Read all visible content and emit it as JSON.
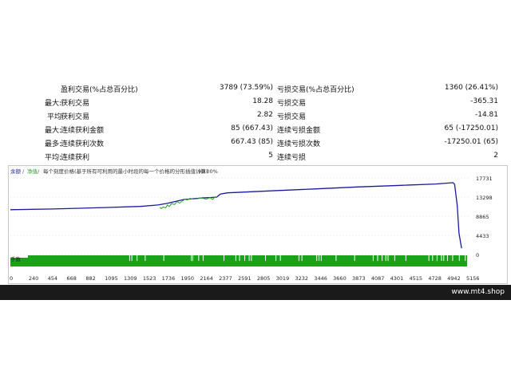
{
  "stats": {
    "rows": [
      {
        "prefix": "",
        "label1": "盈利交易(%占总百分比)",
        "value1": "3789 (73.59%)",
        "label2": "亏损交易(%占总百分比)",
        "value2": "1360 (26.41%)"
      },
      {
        "prefix": "最大:",
        "label1": "获利交易",
        "value1": "18.28",
        "label2": "亏损交易",
        "value2": "-365.31"
      },
      {
        "prefix": "平均",
        "label1": "获利交易",
        "value1": "2.82",
        "label2": "亏损交易",
        "value2": "-14.81"
      },
      {
        "prefix": "最大:",
        "label1": "连续获利金额",
        "value1": "85 (667.43)",
        "label2": "连续亏损金额",
        "value2": "65 (-17250.01)"
      },
      {
        "prefix": "最多:",
        "label1": "连续获利次数",
        "value1": "667.43 (85)",
        "label2": "连续亏损次数",
        "value2": "-17250.01 (65)"
      },
      {
        "prefix": "平均:",
        "label1": "连续获利",
        "value1": "5",
        "label2": "连续亏损",
        "value2": "2"
      }
    ]
  },
  "chart": {
    "legend": {
      "balance": "余额",
      "equity": "净值",
      "separator": "/",
      "description": "每个刻度价格(基于所有可利用的最小时段的每一个价格的分形插值计算)",
      "percent": "90.00%"
    },
    "volume_label": "手数"
  },
  "chart_data": {
    "type": "line",
    "ylim": [
      0,
      19500
    ],
    "yticks": [
      "17731",
      "13298",
      "8865",
      "4433",
      "0"
    ],
    "xlim": [
      0,
      5300
    ],
    "xticks": [
      "0",
      "240",
      "454",
      "668",
      "882",
      "1095",
      "1309",
      "1523",
      "1736",
      "1950",
      "2164",
      "2377",
      "2591",
      "2805",
      "3019",
      "3232",
      "3446",
      "3660",
      "3873",
      "4087",
      "4301",
      "4515",
      "4728",
      "4942",
      "5156"
    ],
    "series": [
      {
        "key": "balance",
        "color": "#1a1aa0",
        "x": [
          0,
          500,
          1000,
          1500,
          1700,
          1800,
          1900,
          2000,
          2100,
          2200,
          2377,
          2420,
          2500,
          2700,
          3000,
          3500,
          4000,
          4500,
          4900,
          5050,
          5100,
          5120,
          5150,
          5170,
          5200
        ],
        "y": [
          11000,
          11200,
          11500,
          11850,
          12200,
          12600,
          13100,
          13600,
          13800,
          14000,
          14200,
          15000,
          15300,
          15500,
          15800,
          16300,
          16800,
          17200,
          17550,
          17800,
          17900,
          17450,
          12000,
          5000,
          1200
        ]
      },
      {
        "key": "equity",
        "color": "#2aa02a",
        "x": [
          1720,
          1740,
          1760,
          1790,
          1810,
          1830,
          1860,
          1890,
          1920,
          1950,
          1980,
          2010,
          2040,
          2070,
          2110,
          2150,
          2200,
          2260,
          2300,
          2330,
          2360,
          2377
        ],
        "y": [
          11600,
          11300,
          11700,
          11500,
          12200,
          11800,
          12600,
          12300,
          13100,
          12700,
          13200,
          13600,
          13500,
          13900,
          13700,
          13800,
          14000,
          13700,
          14100,
          13600,
          14300,
          14200
        ]
      }
    ],
    "volume_ticks": [
      152,
      155,
      162,
      173,
      198,
      235,
      237,
      245,
      251,
      279,
      295,
      300,
      307,
      313,
      316,
      335,
      349,
      355,
      380,
      384,
      404,
      407,
      410,
      430,
      455,
      480,
      486,
      492,
      497,
      500,
      509,
      524,
      555,
      560,
      566,
      572,
      575,
      580,
      587,
      596,
      604,
      612,
      618
    ],
    "colors": {
      "grid": "#dcdcdc",
      "volume_fill": "#1aa31a",
      "volume_tick": "#ffffff",
      "axis_text": "#222222"
    }
  },
  "footer": {
    "watermark": "www.mt4.shop"
  }
}
